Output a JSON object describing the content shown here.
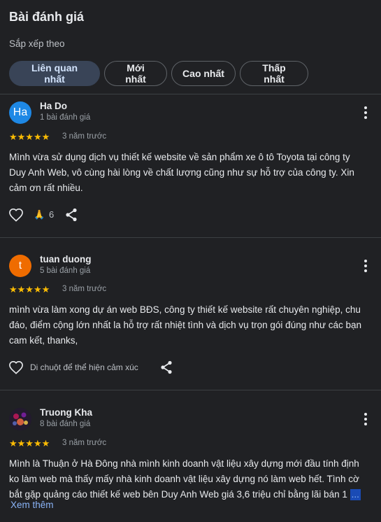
{
  "header": {
    "title": "Bài đánh giá",
    "sort_label": "Sắp xếp theo"
  },
  "sort_options": [
    {
      "label": "Liên quan nhất",
      "active": true
    },
    {
      "label": "Mới nhất",
      "active": false
    },
    {
      "label": "Cao nhất",
      "active": false
    },
    {
      "label": "Thấp nhất",
      "active": false
    }
  ],
  "reviews": [
    {
      "name": "Ha Do",
      "avatar_text": "Ha",
      "avatar_color": "#1e88e5",
      "review_count": "1 bài đánh giá",
      "stars": "★★★★★",
      "rating": 5,
      "time": "3 năm trước",
      "text": "Mình vừa sử dụng dịch vụ thiết kế website về sản phẩm xe ô tô Toyota tại công ty Duy Anh Web, vô cùng hài lòng về chất lượng cũng như sự hỗ trợ của công ty. Xin cảm ơn rất nhiều.",
      "reaction_emoji": "🙏",
      "reaction_count": "6"
    },
    {
      "name": "tuan duong",
      "avatar_text": "t",
      "avatar_color": "#ef6c00",
      "review_count": "5 bài đánh giá",
      "stars": "★★★★★",
      "rating": 5,
      "time": "3 năm trước",
      "text": "mình vừa làm xong dự án web BĐS, công ty thiết kế website rất chuyên nghiệp, chu đáo, điểm cộng lớn nhất la hỗ trợ rất nhiệt tình và dịch vụ trọn gói đúng như các bạn cam kết, thanks,",
      "hover_hint": "Di chuột để thể hiện cảm xúc"
    },
    {
      "name": "Truong Kha",
      "review_count": "8 bài đánh giá",
      "stars": "★★★★★",
      "rating": 5,
      "time": "3 năm trước",
      "text": "Mình là Thuận ở Hà Đông nhà mình kinh doanh vật liệu xây dựng mới đầu tính định ko làm web mà thấy mấy nhà kinh doanh vật liệu xây dựng nó làm web hết. Tình cờ bắt gặp quảng cáo thiết kế web bên Duy Anh Web giá 3,6 triệu chỉ bằng lãi bán 1",
      "ellipsis": "...",
      "see_more": "Xem thêm"
    }
  ]
}
